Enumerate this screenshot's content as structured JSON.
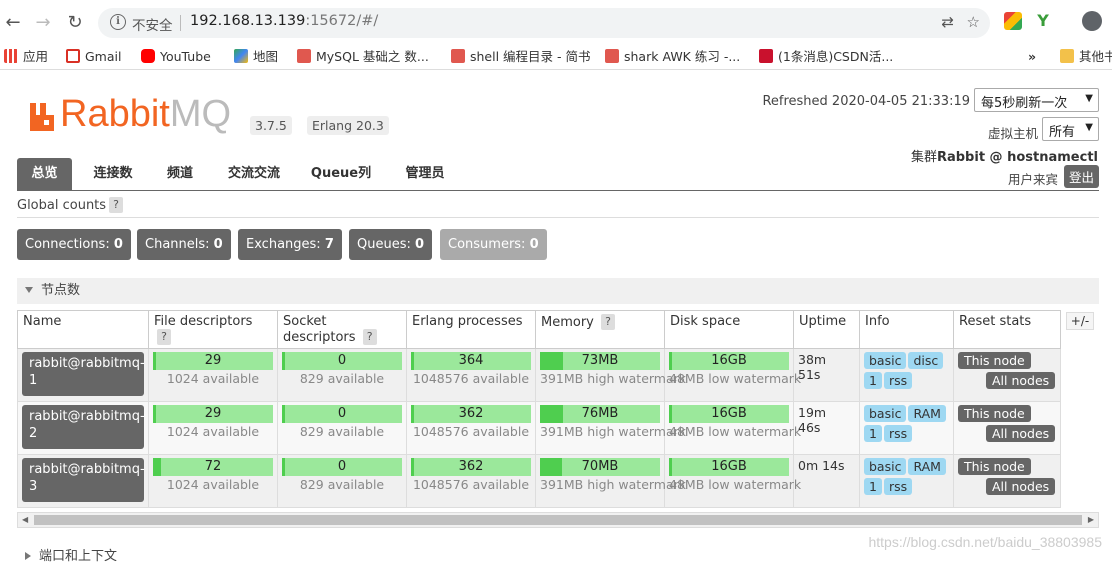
{
  "browser": {
    "insecure_label": "不安全",
    "url_host": "192.168.13.139",
    "url_rest": ":15672/#/",
    "bookmarks": [
      {
        "label": "应用",
        "color": "#e94235"
      },
      {
        "label": "Gmail",
        "color": "#d93025"
      },
      {
        "label": "YouTube",
        "color": "#ff0000"
      },
      {
        "label": "地图",
        "color": "#34a853"
      },
      {
        "label": "MySQL 基础之 数...",
        "color": "#e0584f"
      },
      {
        "label": "shell 编程目录 - 简书",
        "color": "#e0584f"
      },
      {
        "label": "shark AWK 练习 -...",
        "color": "#e0584f"
      },
      {
        "label": "(1条消息)CSDN活...",
        "color": "#c9112d"
      },
      {
        "label": "»",
        "color": ""
      },
      {
        "label": "其他书",
        "color": "#f3c14a"
      }
    ]
  },
  "header": {
    "logo_rabbit": "Rabbit",
    "logo_mq": "MQ",
    "logo_tm": "TM",
    "version": "3.7.5",
    "erlang": "Erlang 20.3",
    "refreshed": "Refreshed 2020-04-05 21:33:19",
    "refresh_option": "每5秒刷新一次",
    "vhost_label": "虚拟主机",
    "vhost_value": "所有",
    "cluster_label": "集群",
    "cluster_value": "Rabbit @ hostnamectl",
    "user_label": "用户来宾",
    "logout": "登出"
  },
  "tabs": [
    "总览",
    "连接数",
    "频道",
    "交流交流",
    "Queue列",
    "管理员"
  ],
  "global_counts": {
    "title": "Global counts",
    "help": "?",
    "items": [
      {
        "label": "Connections:",
        "value": "0"
      },
      {
        "label": "Channels:",
        "value": "0"
      },
      {
        "label": "Exchanges:",
        "value": "7"
      },
      {
        "label": "Queues:",
        "value": "0"
      },
      {
        "label": "Consumers:",
        "value": "0"
      }
    ]
  },
  "nodes": {
    "section_title": "节点数",
    "plus_minus": "+/-",
    "headers": {
      "name": "Name",
      "fd": "File descriptors",
      "sd": "Socket descriptors",
      "erl": "Erlang processes",
      "mem": "Memory",
      "disk": "Disk space",
      "uptime": "Uptime",
      "info": "Info",
      "reset": "Reset stats"
    },
    "rows": [
      {
        "name": "rabbit@rabbitmq-1",
        "fd": "29",
        "fd_sub": "1024 available",
        "fd_frac": 0.028,
        "sd": "0",
        "sd_sub": "829 available",
        "sd_frac": 0,
        "erl": "364",
        "erl_sub": "1048576 available",
        "erl_frac": 0,
        "mem": "73MB",
        "mem_sub": "391MB high watermark",
        "mem_frac": 0.19,
        "disk": "16GB",
        "disk_sub": "48MB low watermark",
        "disk_frac": 0,
        "uptime1": "38m",
        "uptime2": "51s",
        "tags": [
          "basic",
          "disc",
          "1",
          "rss"
        ],
        "this_node": "This node",
        "all_nodes": "All nodes"
      },
      {
        "name": "rabbit@rabbitmq-2",
        "fd": "29",
        "fd_sub": "1024 available",
        "fd_frac": 0.028,
        "sd": "0",
        "sd_sub": "829 available",
        "sd_frac": 0,
        "erl": "362",
        "erl_sub": "1048576 available",
        "erl_frac": 0,
        "mem": "76MB",
        "mem_sub": "391MB high watermark",
        "mem_frac": 0.19,
        "disk": "16GB",
        "disk_sub": "48MB low watermark",
        "disk_frac": 0,
        "uptime1": "19m",
        "uptime2": "46s",
        "tags": [
          "basic",
          "RAM",
          "1",
          "rss"
        ],
        "this_node": "This node",
        "all_nodes": "All nodes"
      },
      {
        "name": "rabbit@rabbitmq-3",
        "fd": "72",
        "fd_sub": "1024 available",
        "fd_frac": 0.07,
        "sd": "0",
        "sd_sub": "829 available",
        "sd_frac": 0,
        "erl": "362",
        "erl_sub": "1048576 available",
        "erl_frac": 0,
        "mem": "70MB",
        "mem_sub": "391MB high watermark",
        "mem_frac": 0.18,
        "disk": "16GB",
        "disk_sub": "48MB low watermark",
        "disk_frac": 0,
        "uptime1": "0m 14s",
        "uptime2": "",
        "tags": [
          "basic",
          "RAM",
          "1",
          "rss"
        ],
        "this_node": "This node",
        "all_nodes": "All nodes"
      }
    ]
  },
  "ports_section": "端口和上下文",
  "watermark": "https://blog.csdn.net/baidu_38803985"
}
